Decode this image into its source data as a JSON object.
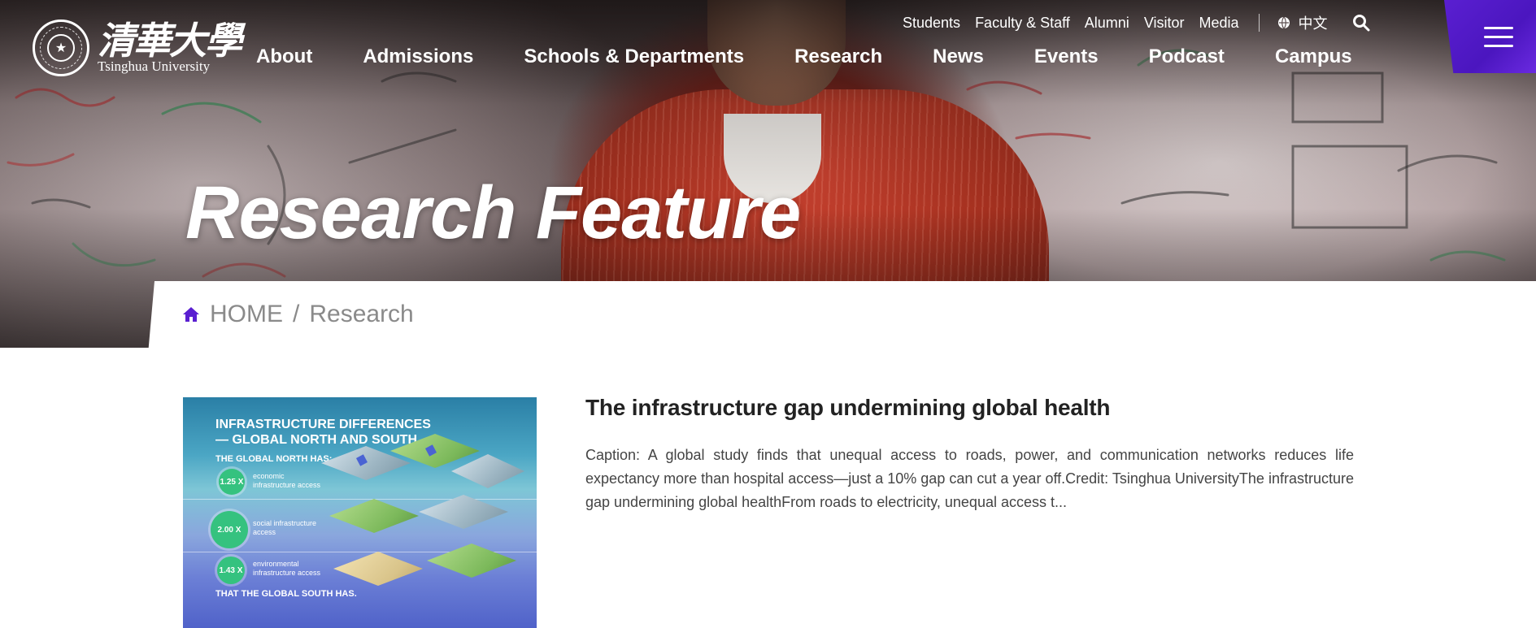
{
  "brand": {
    "name_cn": "清華大學",
    "name_en": "Tsinghua University"
  },
  "utility_nav": {
    "items": [
      "Students",
      "Faculty & Staff",
      "Alumni",
      "Visitor",
      "Media"
    ],
    "language": "中文",
    "icons": {
      "language": "globe-icon",
      "search": "search-icon"
    }
  },
  "main_nav": {
    "items": [
      "About",
      "Admissions",
      "Schools & Departments",
      "Research",
      "News",
      "Events",
      "Podcast",
      "Campus"
    ]
  },
  "menu_button": {
    "icon": "hamburger-icon",
    "color": "#5a1fd1"
  },
  "hero": {
    "title": "Research Feature"
  },
  "breadcrumb": {
    "home": "HOME",
    "separator": "/",
    "current": "Research",
    "home_icon_color": "#5a1fd1"
  },
  "article": {
    "title": "The infrastructure gap undermining global health",
    "excerpt": "Caption: A global study finds that unequal access to roads, power, and communication networks reduces life expectancy more than hospital access—just a 10% gap can cut a year off.Credit: Tsinghua UniversityThe infrastructure gap undermining global healthFrom roads to electricity, unequal access t...",
    "thumbnail": {
      "title": "INFRASTRUCTURE DIFFERENCES — GLOBAL NORTH AND SOUTH",
      "subtitle": "THE GLOBAL NORTH HAS:",
      "stats": [
        {
          "value": "1.25 X",
          "label": "economic infrastructure access"
        },
        {
          "value": "2.00 X",
          "label": "social infrastructure access"
        },
        {
          "value": "1.43 X",
          "label": "environmental infrastructure access"
        }
      ],
      "footer": "THAT THE GLOBAL SOUTH HAS."
    }
  },
  "colors": {
    "accent": "#5a1fd1",
    "title_text": "#222222",
    "body_text": "#444444",
    "crumb_text": "#8a8a8a"
  }
}
